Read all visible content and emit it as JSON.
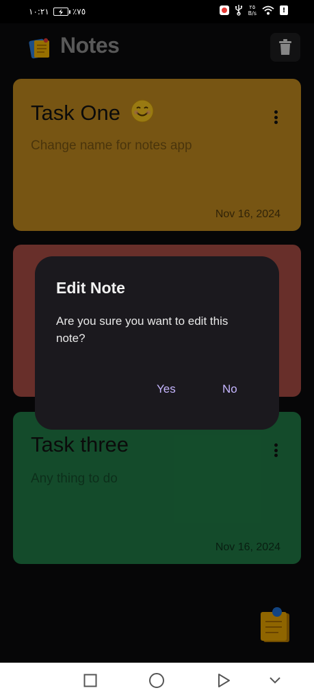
{
  "status_bar": {
    "time": "١٠:٢١",
    "battery_level": "٧٥",
    "battery_percent": "٪٧٥",
    "network_speed_value": "٢٥",
    "network_speed_unit": "B/s",
    "alert_glyph": "!"
  },
  "app_bar": {
    "title": "Notes",
    "logo_icon": "sticky-note-icon",
    "delete_icon": "trash-icon"
  },
  "notes": [
    {
      "title": "Task One",
      "emoji": "smiling-face-icon",
      "description": "Change name for notes app",
      "date": "Nov 16, 2024",
      "color": "#c18a20"
    },
    {
      "title": "",
      "description": "",
      "date": "",
      "color": "#a84c44"
    },
    {
      "title": "Task three",
      "description": "Any thing to do",
      "date": "Nov 16, 2024",
      "color": "#217a46"
    }
  ],
  "dialog": {
    "title": "Edit Note",
    "message": "Are you sure you want to edit this note?",
    "yes_label": "Yes",
    "no_label": "No"
  },
  "fab": {
    "icon": "add-note-icon"
  },
  "nav_bar": {
    "back_icon": "square-icon",
    "home_icon": "circle-icon",
    "recent_icon": "triangle-icon",
    "down_icon": "chevron-down-icon"
  },
  "colors": {
    "background": "#0b0b0c",
    "dialog": "#1b191e",
    "accent": "#c6b6ff",
    "title_gray": "#8e8e8e"
  }
}
